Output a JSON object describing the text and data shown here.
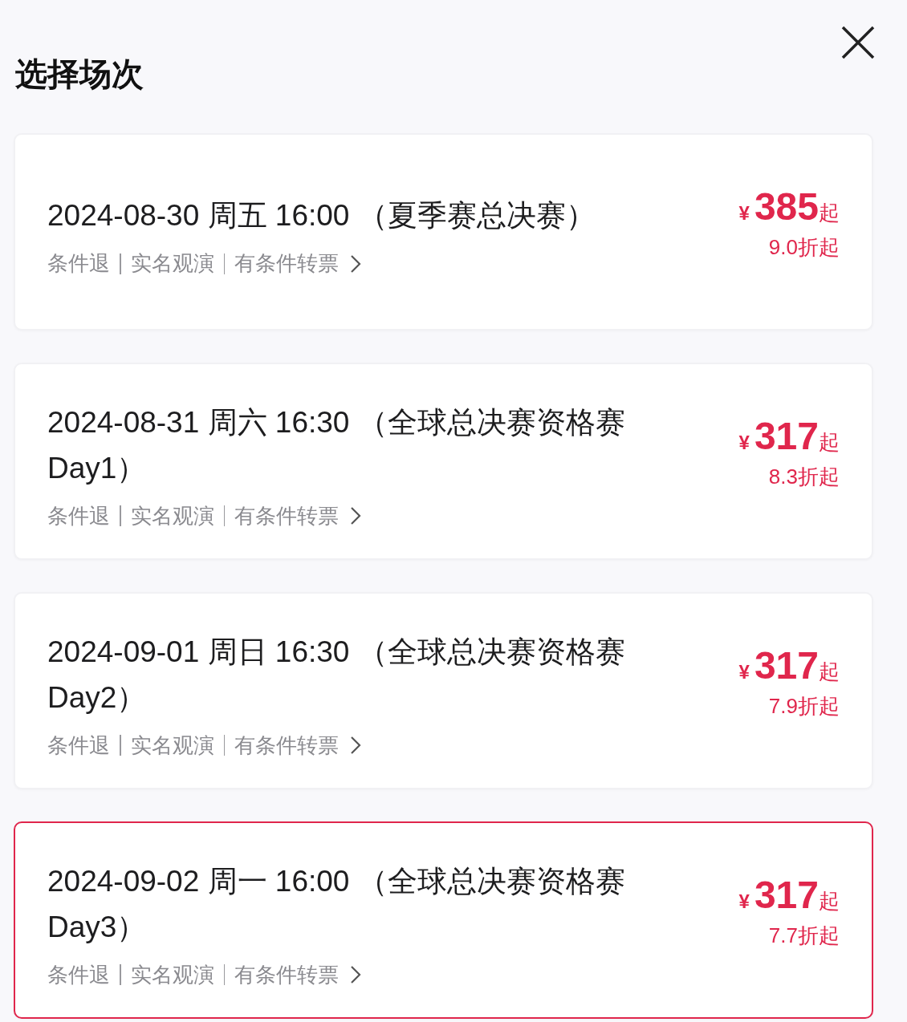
{
  "header": {
    "title": "选择场次"
  },
  "sessions": [
    {
      "title": "2024-08-30 周五 16:00 （夏季赛总决赛）",
      "policies": [
        "条件退",
        "实名观演",
        "有条件转票"
      ],
      "price": {
        "currency": "¥",
        "amount": "385",
        "suffix": "起"
      },
      "discount": "9.0折起",
      "selected": false
    },
    {
      "title": "2024-08-31 周六 16:30 （全球总决赛资格赛Day1）",
      "policies": [
        "条件退",
        "实名观演",
        "有条件转票"
      ],
      "price": {
        "currency": "¥",
        "amount": "317",
        "suffix": "起"
      },
      "discount": "8.3折起",
      "selected": false
    },
    {
      "title": "2024-09-01 周日 16:30 （全球总决赛资格赛Day2）",
      "policies": [
        "条件退",
        "实名观演",
        "有条件转票"
      ],
      "price": {
        "currency": "¥",
        "amount": "317",
        "suffix": "起"
      },
      "discount": "7.9折起",
      "selected": false
    },
    {
      "title": "2024-09-02 周一 16:00 （全球总决赛资格赛Day3）",
      "policies": [
        "条件退",
        "实名观演",
        "有条件转票"
      ],
      "price": {
        "currency": "¥",
        "amount": "317",
        "suffix": "起"
      },
      "discount": "7.7折起",
      "selected": true
    }
  ]
}
